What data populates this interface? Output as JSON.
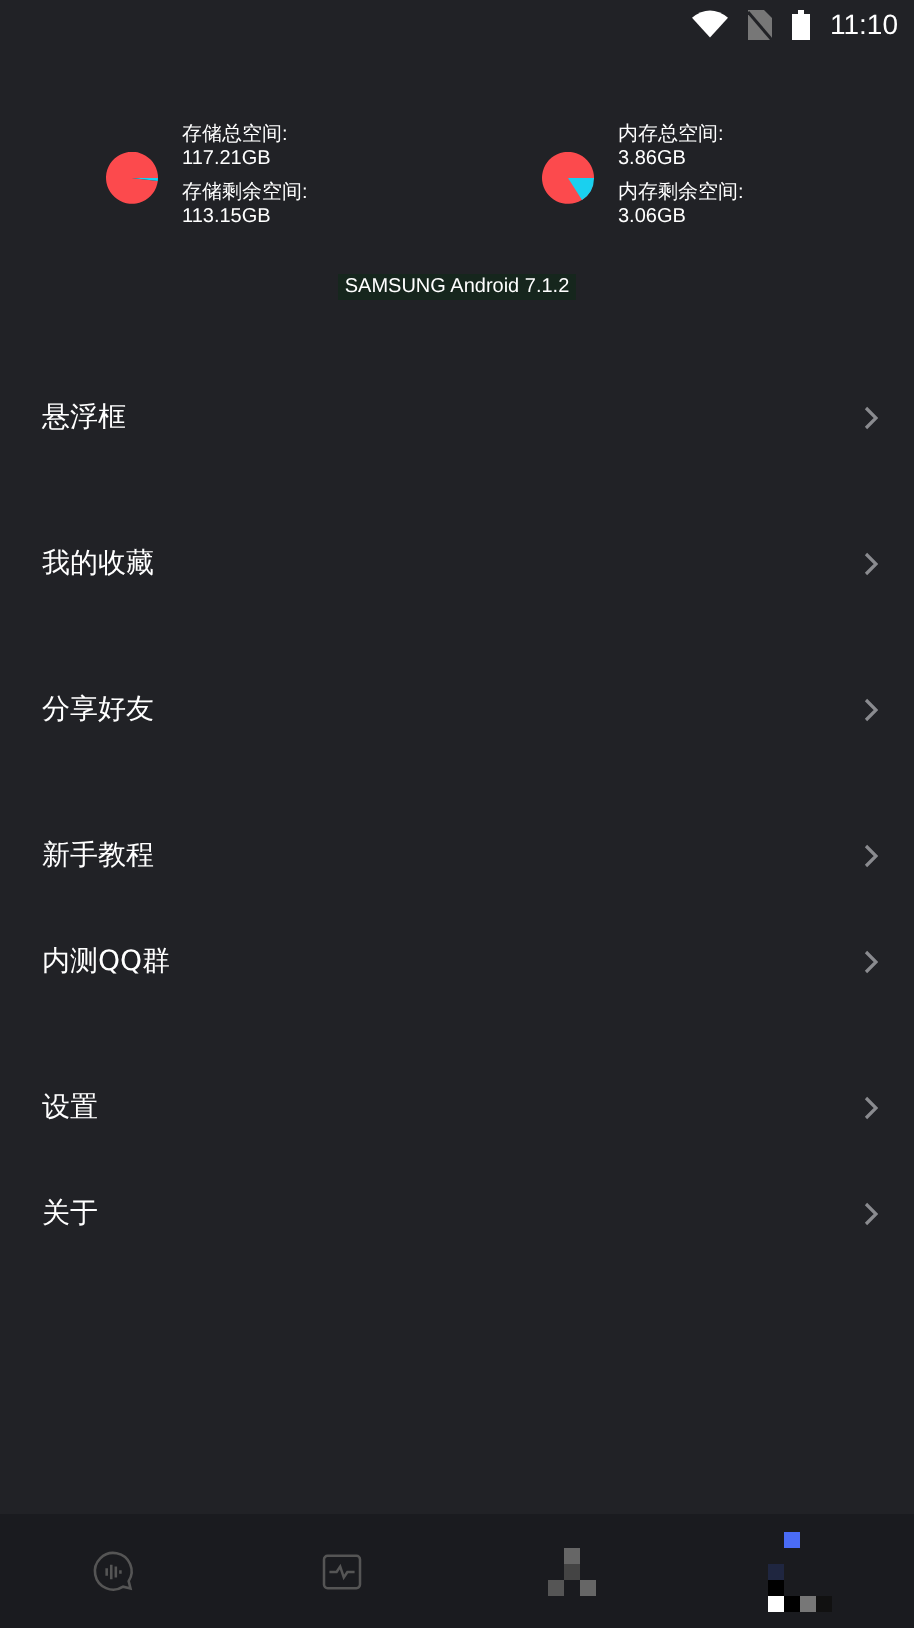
{
  "status_bar": {
    "time": "11:10"
  },
  "storage": [
    {
      "total_label": "存储总空间:",
      "total": "117.21GB",
      "free_label": "存储剩余空间:",
      "free": "113.15GB"
    },
    {
      "total_label": "内存总空间:",
      "total": "3.86GB",
      "free_label": "内存剩余空间:",
      "free": "3.06GB"
    }
  ],
  "device_label": "SAMSUNG Android 7.1.2",
  "menu_groups": [
    {
      "items": [
        {
          "label": "悬浮框"
        }
      ]
    },
    {
      "items": [
        {
          "label": "我的收藏"
        }
      ]
    },
    {
      "items": [
        {
          "label": "分享好友"
        }
      ]
    },
    {
      "items": [
        {
          "label": "新手教程"
        },
        {
          "label": "内测QQ群"
        }
      ]
    },
    {
      "items": [
        {
          "label": "设置"
        },
        {
          "label": "关于"
        }
      ]
    }
  ],
  "bottom_nav": [
    {
      "kind": "voice"
    },
    {
      "kind": "monitor"
    },
    {
      "kind": "pixels"
    },
    {
      "kind": "glitch"
    }
  ]
}
